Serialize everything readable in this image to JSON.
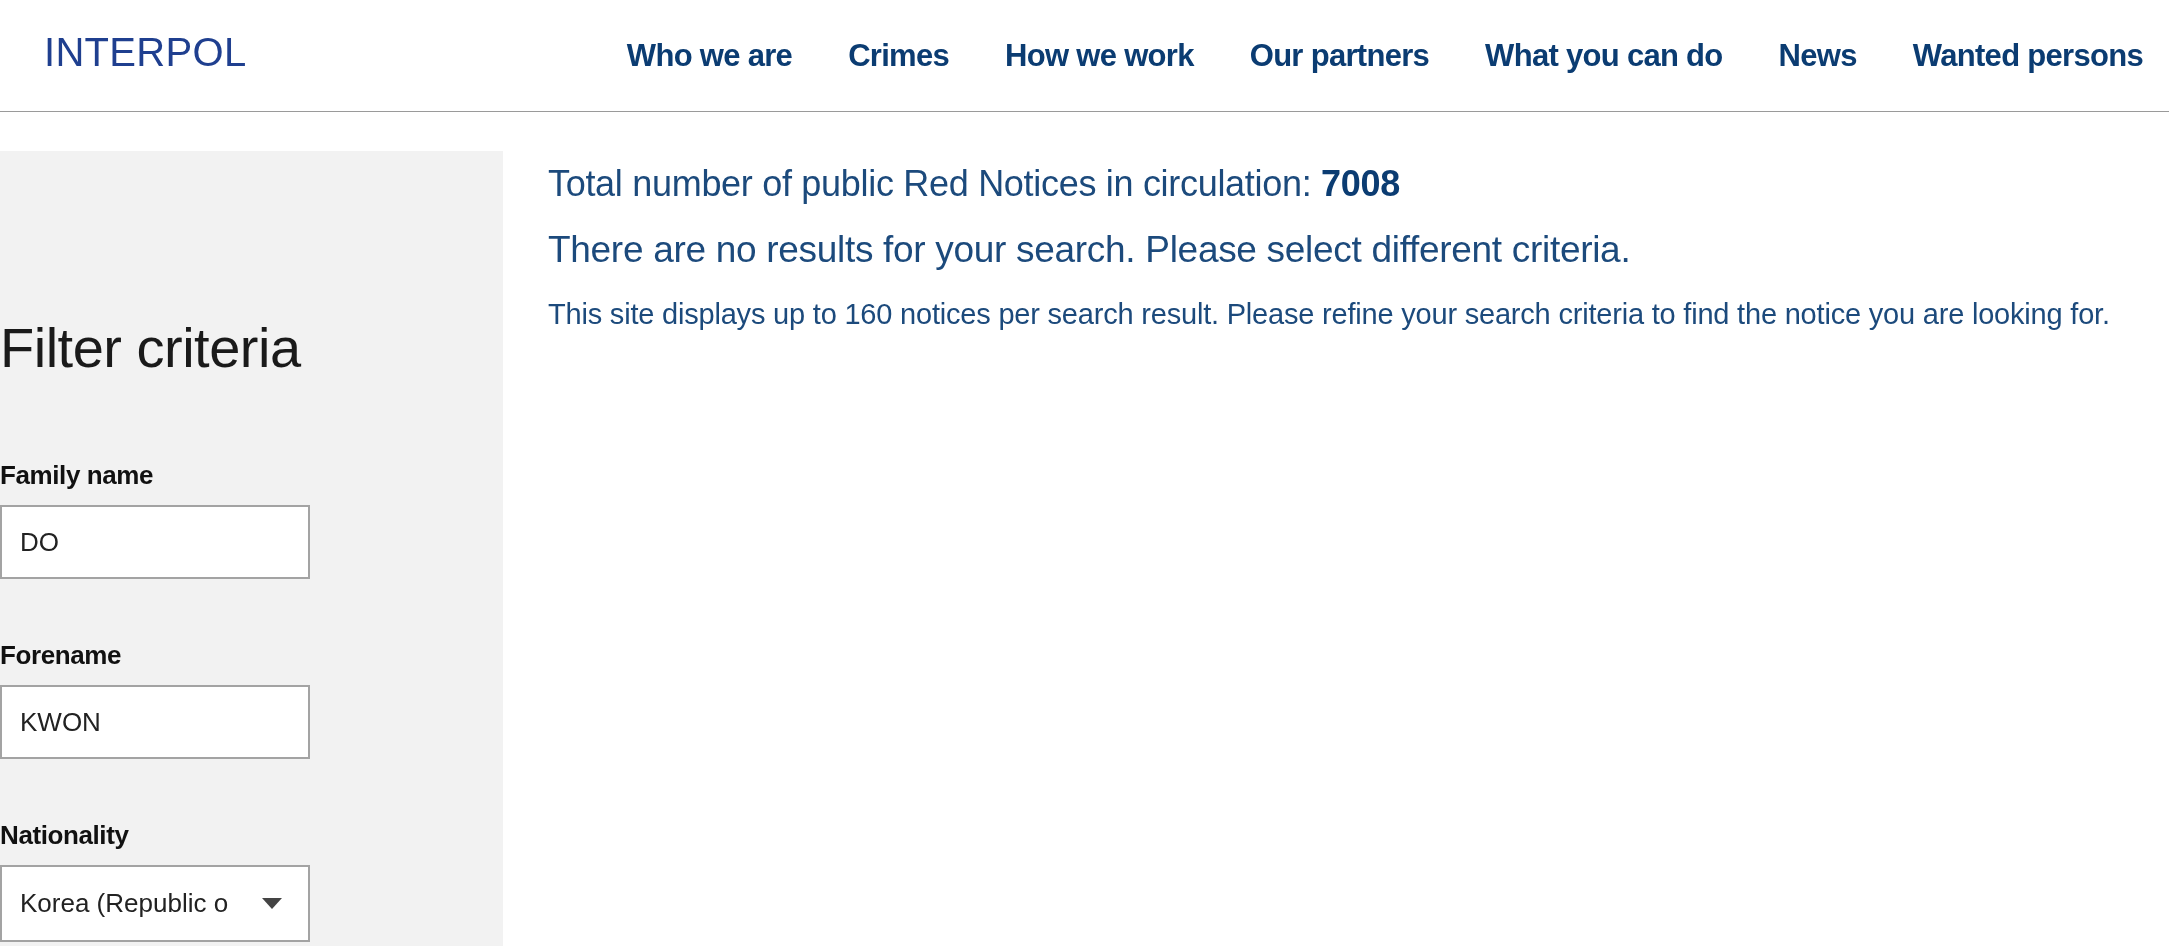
{
  "header": {
    "logo": "INTERPOL",
    "nav": [
      "Who we are",
      "Crimes",
      "How we work",
      "Our partners",
      "What you can do",
      "News",
      "Wanted persons"
    ]
  },
  "filters": {
    "title": "Filter criteria",
    "fields": [
      {
        "kind": "text",
        "label": "Family name",
        "value": "DO"
      },
      {
        "kind": "text",
        "label": "Forename",
        "value": "KWON"
      },
      {
        "kind": "select",
        "label": "Nationality",
        "value": "Korea (Republic o"
      }
    ]
  },
  "results": {
    "total": "Total number of public Red Notices in circulation: **7008**",
    "message": "There are no results for your search. Please select different criteria.",
    "note": "This site displays up to 160 notices per search result. Please refine your search criteria to find the notice you are looking for."
  }
}
